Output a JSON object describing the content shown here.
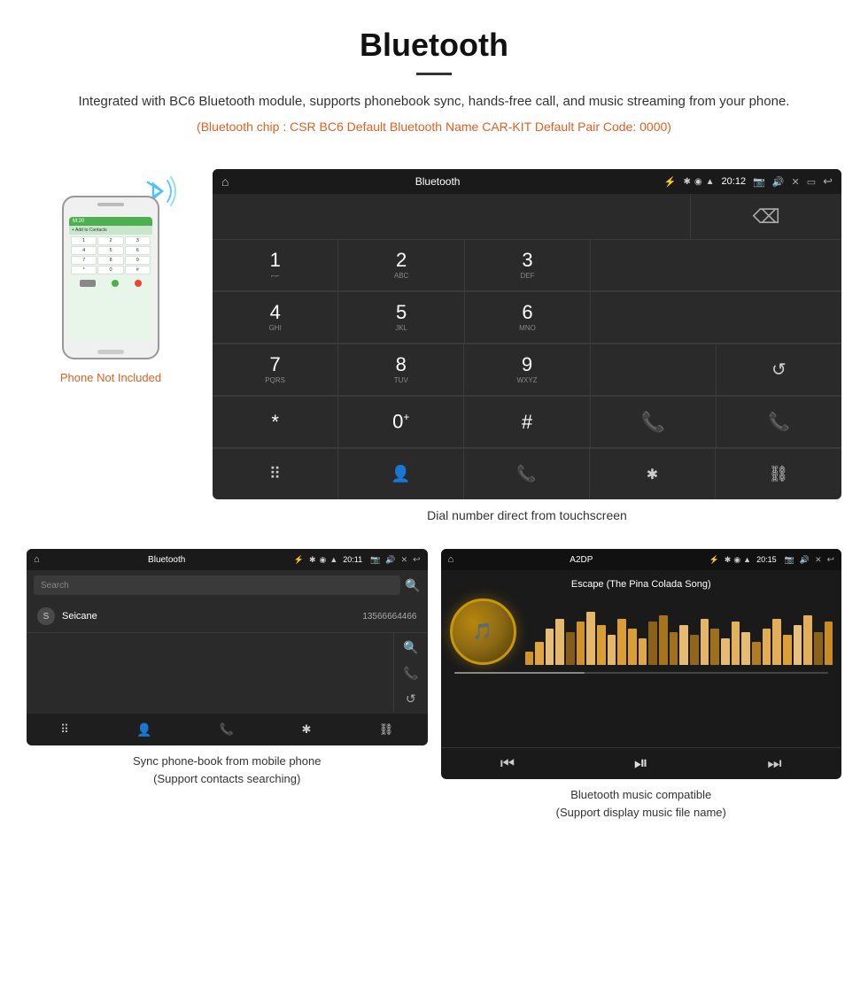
{
  "header": {
    "title": "Bluetooth",
    "description": "Integrated with BC6 Bluetooth module, supports phonebook sync, hands-free call, and music streaming from your phone.",
    "specs": "(Bluetooth chip : CSR BC6    Default Bluetooth Name CAR-KIT    Default Pair Code: 0000)"
  },
  "phone_label": "Phone Not Included",
  "dial_screen": {
    "status_title": "Bluetooth",
    "time": "20:12",
    "keys": [
      {
        "num": "1",
        "sub": "⌐⌐"
      },
      {
        "num": "2",
        "sub": "ABC"
      },
      {
        "num": "3",
        "sub": "DEF"
      },
      {
        "num": "",
        "sub": ""
      },
      {
        "num": "⌫",
        "sub": ""
      },
      {
        "num": "4",
        "sub": "GHI"
      },
      {
        "num": "5",
        "sub": "JKL"
      },
      {
        "num": "6",
        "sub": "MNO"
      },
      {
        "num": "",
        "sub": ""
      },
      {
        "num": "",
        "sub": ""
      },
      {
        "num": "7",
        "sub": "PQRS"
      },
      {
        "num": "8",
        "sub": "TUV"
      },
      {
        "num": "9",
        "sub": "WXYZ"
      },
      {
        "num": "",
        "sub": ""
      },
      {
        "num": "↺",
        "sub": ""
      },
      {
        "num": "*",
        "sub": ""
      },
      {
        "num": "0",
        "sub": "+"
      },
      {
        "num": "#",
        "sub": ""
      },
      {
        "num": "📞",
        "sub": ""
      },
      {
        "num": "📞red",
        "sub": ""
      }
    ],
    "bottom_icons": [
      "⠿",
      "👤",
      "📞",
      "✱",
      "⛓"
    ]
  },
  "dial_caption": "Dial number direct from touchscreen",
  "phonebook": {
    "status_title": "Bluetooth",
    "time": "20:11",
    "search_placeholder": "Search",
    "contact_letter": "S",
    "contact_name": "Seicane",
    "contact_number": "13566664466",
    "caption_line1": "Sync phone-book from mobile phone",
    "caption_line2": "(Support contacts searching)"
  },
  "music": {
    "status_title": "A2DP",
    "time": "20:15",
    "song_name": "Escape (The Pina Colada Song)",
    "caption_line1": "Bluetooth music compatible",
    "caption_line2": "(Support display music file name)"
  },
  "equalizer_bars": [
    20,
    35,
    55,
    70,
    50,
    65,
    80,
    60,
    45,
    70,
    55,
    40,
    65,
    75,
    50,
    60,
    45,
    70,
    55,
    40,
    65,
    50,
    35,
    55,
    70,
    45,
    60,
    75,
    50,
    65
  ]
}
